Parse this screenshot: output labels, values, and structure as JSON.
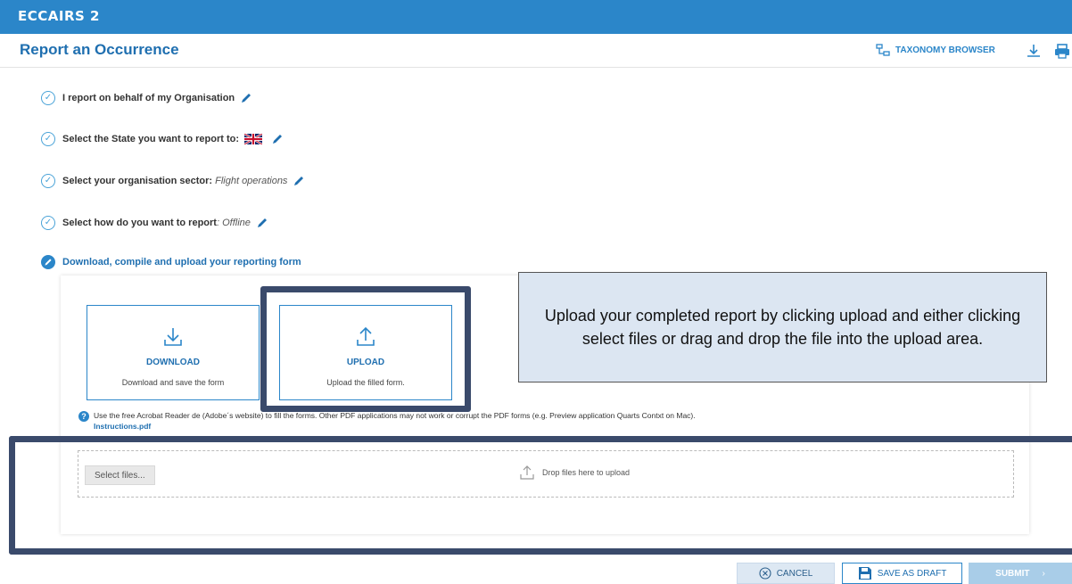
{
  "app": {
    "logo_text": "ECCAIRS 2"
  },
  "header": {
    "title": "Report an Occurrence",
    "taxonomy_label": "TAXONOMY BROWSER",
    "accent": "#2b86c9"
  },
  "steps": [
    {
      "label": "I report on behalf of my Organisation",
      "value": ""
    },
    {
      "label": "Select the State you want to report to:",
      "value": "",
      "flag": "uk-flag-icon"
    },
    {
      "label": "Select your organisation sector:",
      "value": "Flight operations"
    },
    {
      "label": "Select how do you want to report",
      "value": ": Offline"
    }
  ],
  "active_step": {
    "label": "Download, compile and upload your reporting form"
  },
  "cards": {
    "download": {
      "title": "DOWNLOAD",
      "desc": "Download and save the form"
    },
    "upload": {
      "title": "UPLOAD",
      "desc": "Upload the filled form."
    }
  },
  "callout": {
    "text": "Upload your completed report by clicking upload and either clicking select files or drag and drop the file into the upload area."
  },
  "help": {
    "text": "Use the free Acrobat Reader de (Adobe´s website) to fill the forms. Other PDF applications may not work or corrupt the PDF forms (e.g. Preview application Quarts Contxt on Mac).",
    "link": "Instructions.pdf"
  },
  "upload_area": {
    "select_label": "Select files...",
    "drop_label": "Drop files here to upload"
  },
  "actions": {
    "cancel": "CANCEL",
    "save_draft": "SAVE AS DRAFT",
    "submit": "SUBMIT"
  }
}
